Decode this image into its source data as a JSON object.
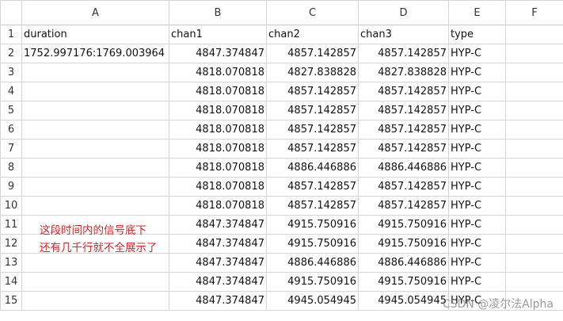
{
  "columns": [
    "A",
    "B",
    "C",
    "D",
    "E",
    "F"
  ],
  "header_row": {
    "number": "1",
    "cells": [
      "duration",
      "chan1",
      "chan2",
      "chan3",
      "type",
      ""
    ]
  },
  "rows": [
    {
      "number": "2",
      "cells": [
        "1752.997176:1769.003964",
        "4847.374847",
        "4857.142857",
        "4857.142857",
        "HYP-C",
        ""
      ]
    },
    {
      "number": "3",
      "cells": [
        "",
        "4818.070818",
        "4827.838828",
        "4827.838828",
        "HYP-C",
        ""
      ]
    },
    {
      "number": "4",
      "cells": [
        "",
        "4818.070818",
        "4857.142857",
        "4857.142857",
        "HYP-C",
        ""
      ]
    },
    {
      "number": "5",
      "cells": [
        "",
        "4818.070818",
        "4857.142857",
        "4857.142857",
        "HYP-C",
        ""
      ]
    },
    {
      "number": "6",
      "cells": [
        "",
        "4818.070818",
        "4857.142857",
        "4857.142857",
        "HYP-C",
        ""
      ]
    },
    {
      "number": "7",
      "cells": [
        "",
        "4818.070818",
        "4857.142857",
        "4857.142857",
        "HYP-C",
        ""
      ]
    },
    {
      "number": "8",
      "cells": [
        "",
        "4818.070818",
        "4886.446886",
        "4886.446886",
        "HYP-C",
        ""
      ]
    },
    {
      "number": "9",
      "cells": [
        "",
        "4818.070818",
        "4857.142857",
        "4857.142857",
        "HYP-C",
        ""
      ]
    },
    {
      "number": "10",
      "cells": [
        "",
        "4818.070818",
        "4857.142857",
        "4857.142857",
        "HYP-C",
        ""
      ]
    },
    {
      "number": "11",
      "cells": [
        "",
        "4847.374847",
        "4915.750916",
        "4915.750916",
        "HYP-C",
        ""
      ]
    },
    {
      "number": "12",
      "cells": [
        "",
        "4847.374847",
        "4915.750916",
        "4915.750916",
        "HYP-C",
        ""
      ]
    },
    {
      "number": "13",
      "cells": [
        "",
        "4847.374847",
        "4886.446886",
        "4886.446886",
        "HYP-C",
        ""
      ]
    },
    {
      "number": "14",
      "cells": [
        "",
        "4847.374847",
        "4915.750916",
        "4915.750916",
        "HYP-C",
        ""
      ]
    },
    {
      "number": "15",
      "cells": [
        "",
        "4847.374847",
        "4945.054945",
        "4945.054945",
        "HYP-C",
        ""
      ]
    }
  ],
  "annotation": {
    "line1": "这段时间内的信号底下",
    "line2": "还有几千行就不全展示了",
    "color": "#e02020"
  },
  "watermark": "CSDN @凌尔法Alpha"
}
